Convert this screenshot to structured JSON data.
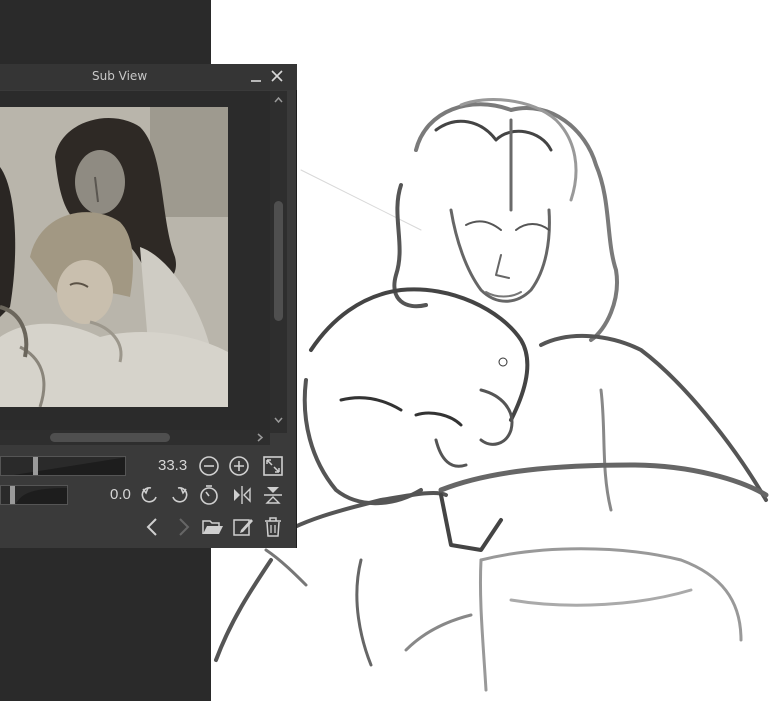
{
  "window": {
    "title": "Sub View"
  },
  "zoom": {
    "value": "33.3",
    "level_fraction": 0.27
  },
  "rotation": {
    "value": "0.0"
  },
  "icons": {
    "minimize": "minimize-icon",
    "close": "close-icon",
    "zoom_out": "zoom-out-icon",
    "zoom_in": "zoom-in-icon",
    "fit": "fit-to-view-icon",
    "rotate_left": "rotate-left-icon",
    "rotate_right": "rotate-right-icon",
    "reset_rotation": "reset-rotation-icon",
    "flip_horizontal": "flip-horizontal-icon",
    "flip_vertical": "flip-vertical-icon",
    "previous": "previous-icon",
    "next": "next-icon",
    "import": "open-folder-icon",
    "edit": "edit-icon",
    "delete": "trash-icon"
  },
  "colors": {
    "panel": "#3a3a3a",
    "canvas": "#ffffff",
    "accent": "#c8c8c8"
  }
}
